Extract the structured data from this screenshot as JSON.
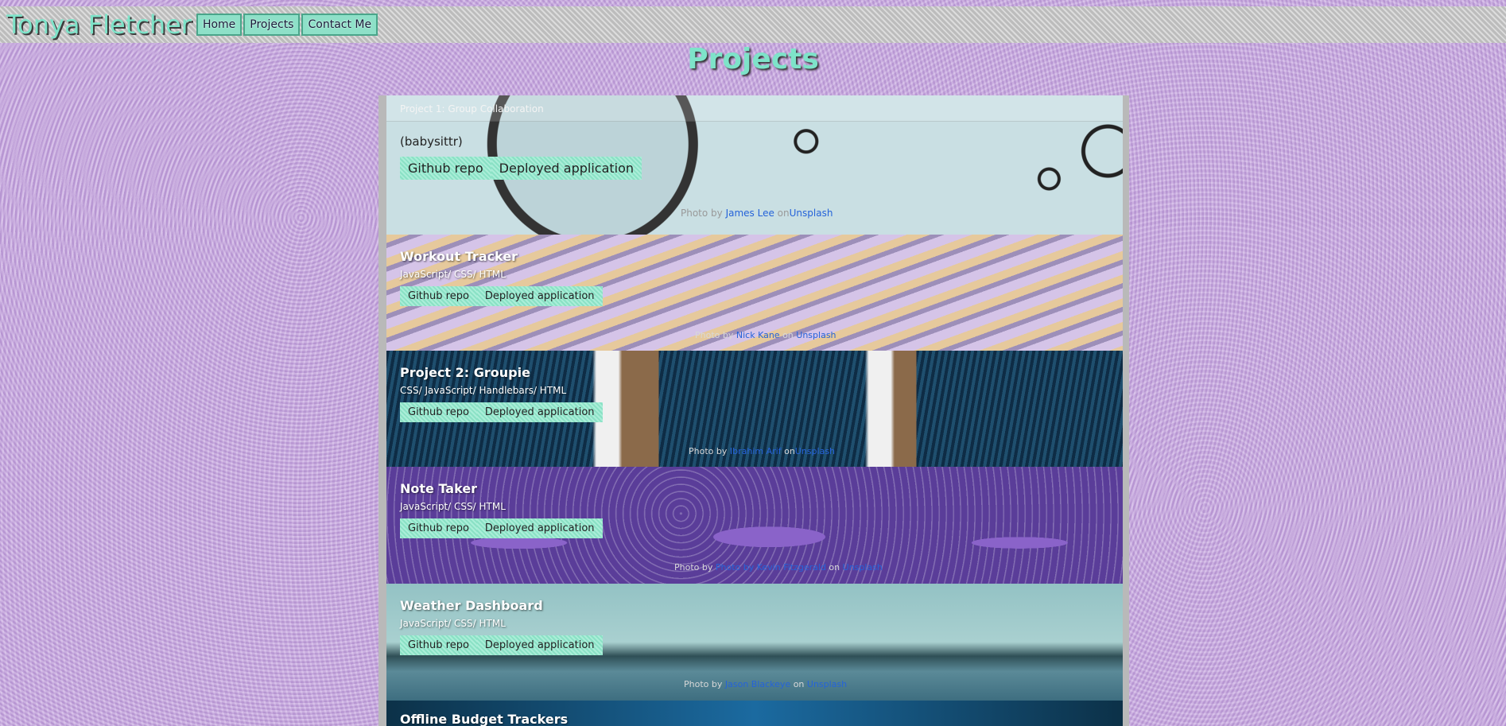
{
  "header": {
    "brand": "Tonya Fletcher",
    "nav": [
      {
        "label": "Home"
      },
      {
        "label": "Projects"
      },
      {
        "label": "Contact Me"
      }
    ]
  },
  "page": {
    "title": "Projects"
  },
  "projects": [
    {
      "head": "Project 1: Group Collaboration",
      "subtitle": "(babysittr)",
      "github": "Github repo",
      "deployed": "Deployed application",
      "credit": {
        "prefix": "Photo by ",
        "author": "James Lee",
        "mid": " on",
        "site": "Unsplash"
      }
    },
    {
      "title": "Workout Tracker",
      "subtitle": "JavaScript/ CSS/ HTML",
      "github": "Github repo",
      "deployed": "Deployed application",
      "credit": {
        "prefix": "Photo by ",
        "author": "Nick Kane",
        "mid": " on ",
        "site": "Unsplash"
      }
    },
    {
      "title": "Project 2: Groupie",
      "subtitle": "CSS/ JavaScript/ Handlebars/ HTML",
      "github": "Github repo",
      "deployed": "Deployed application",
      "credit": {
        "prefix": "Photo by ",
        "author": "Ibrahim Arif",
        "mid": " on",
        "site": "Unsplash"
      }
    },
    {
      "title": "Note Taker",
      "subtitle": "JavaScript/ CSS/ HTML",
      "github": "Github repo",
      "deployed": "Deployed application",
      "credit": {
        "prefix": "Photo by ",
        "author": "Photo by Kevin Fitzgerald",
        "mid": " on ",
        "site": "Unsplash"
      }
    },
    {
      "title": "Weather Dashboard",
      "subtitle": "JavaScript/ CSS/ HTML",
      "github": "Github repo",
      "deployed": "Deployed application",
      "credit": {
        "prefix": "Photo by ",
        "author": "Jason Blackeye",
        "mid": " on ",
        "site": "Unsplash"
      }
    },
    {
      "title": "Offline Budget Trackers"
    }
  ]
}
